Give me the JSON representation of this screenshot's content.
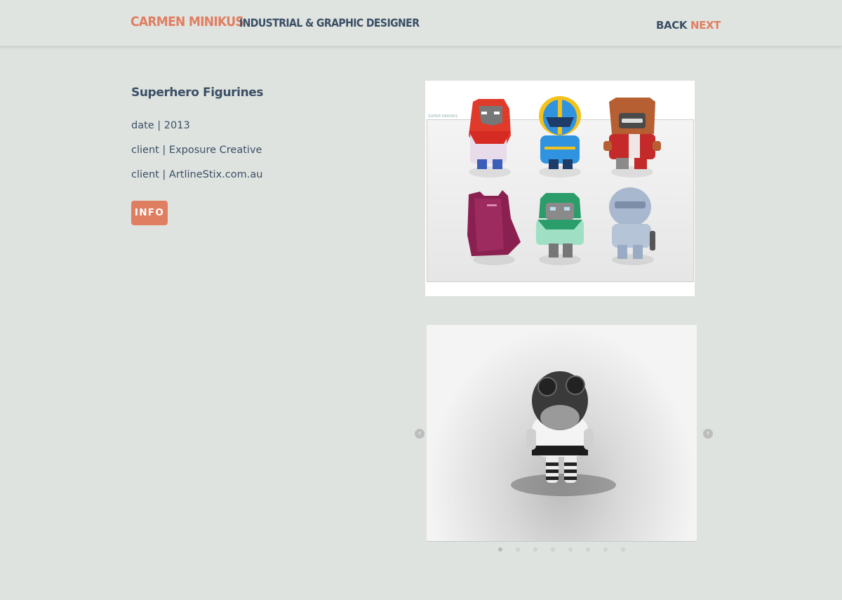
{
  "header": {
    "brand_name": "CARMEN MINIKUS",
    "brand_role": "INDUSTRIAL & GRAPHIC DESIGNER",
    "back_label": "BACK",
    "next_label": "NEXT"
  },
  "project": {
    "title": "Superhero Figurines",
    "meta": [
      "date | 2013",
      "client | Exposure Creative",
      "client | ArtlineStix.com.au"
    ],
    "info_label": "INFO"
  },
  "gallery": {
    "sheet_label": "SUPER HEROES",
    "prev_icon": "chevron-left-icon",
    "next_icon": "chevron-right-icon",
    "slide_count": 8,
    "active_slide": 1
  },
  "colors": {
    "accent": "#e07e62",
    "text": "#3b4f66",
    "background": "#dfe3df"
  }
}
